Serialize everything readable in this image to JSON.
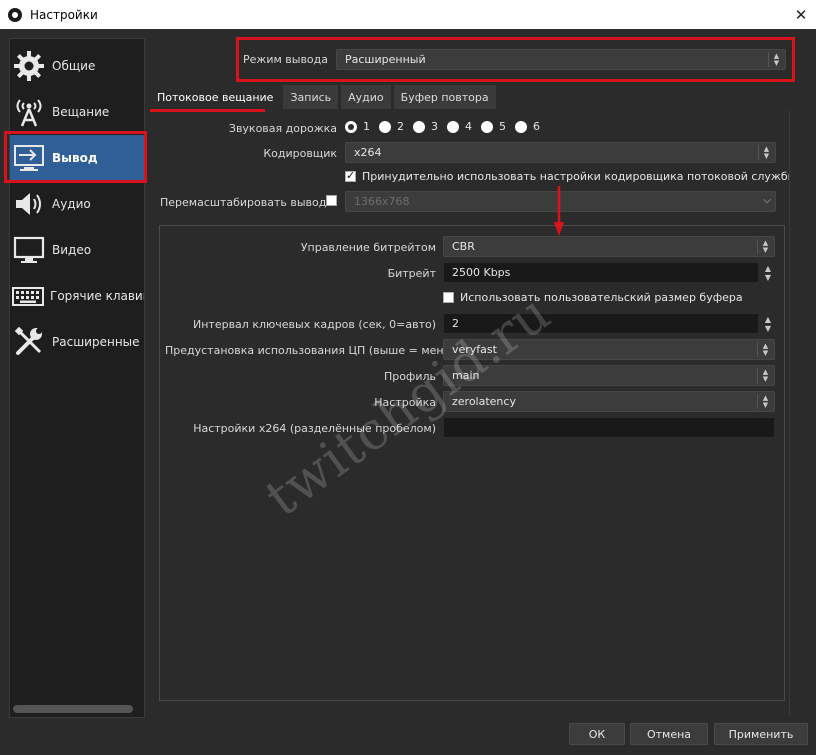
{
  "window": {
    "title": "Настройки",
    "close_glyph": "✕"
  },
  "sidebar": {
    "items": [
      {
        "label": "Общие",
        "icon": "gear-icon"
      },
      {
        "label": "Вещание",
        "icon": "broadcast-icon"
      },
      {
        "label": "Вывод",
        "icon": "output-icon",
        "active": true
      },
      {
        "label": "Аудио",
        "icon": "speaker-icon"
      },
      {
        "label": "Видео",
        "icon": "monitor-icon"
      },
      {
        "label": "Горячие клавиши",
        "icon": "keyboard-icon"
      },
      {
        "label": "Расширенные",
        "icon": "tools-icon"
      }
    ]
  },
  "output_mode": {
    "label": "Режим вывода",
    "value": "Расширенный"
  },
  "tabs": [
    {
      "label": "Потоковое вещание",
      "active": true
    },
    {
      "label": "Запись"
    },
    {
      "label": "Аудио"
    },
    {
      "label": "Буфер повтора"
    }
  ],
  "streaming": {
    "audio_track_label": "Звуковая дорожка",
    "audio_tracks": [
      "1",
      "2",
      "3",
      "4",
      "5",
      "6"
    ],
    "audio_track_selected": "1",
    "encoder_label": "Кодировщик",
    "encoder_value": "x264",
    "enforce_label": "Принудительно использовать настройки кодировщика потоковой службы",
    "enforce_checked": true,
    "rescale_label": "Перемасштабировать вывод",
    "rescale_checked": false,
    "rescale_value": "1366x768"
  },
  "encoder_settings": {
    "rate_control_label": "Управление битрейтом",
    "rate_control_value": "CBR",
    "bitrate_label": "Битрейт",
    "bitrate_value": "2500 Kbps",
    "custom_buffer_label": "Использовать пользовательский размер буфера",
    "custom_buffer_checked": false,
    "keyframe_label": "Интервал ключевых кадров (сек, 0=авто)",
    "keyframe_value": "2",
    "cpu_preset_label": "Предустановка использования ЦП (выше = меньше)",
    "cpu_preset_value": "veryfast",
    "profile_label": "Профиль",
    "profile_value": "main",
    "tune_label": "Настройка",
    "tune_value": "zerolatency",
    "x264_opts_label": "Настройки x264 (разделённые пробелом)",
    "x264_opts_value": ""
  },
  "watermark": "twitchgid.ru",
  "buttons": {
    "ok": "ОК",
    "cancel": "Отмена",
    "apply": "Применить"
  },
  "colors": {
    "highlight": "#d8131b",
    "active_item": "#2f5f96",
    "panel": "#2b2b2b"
  }
}
